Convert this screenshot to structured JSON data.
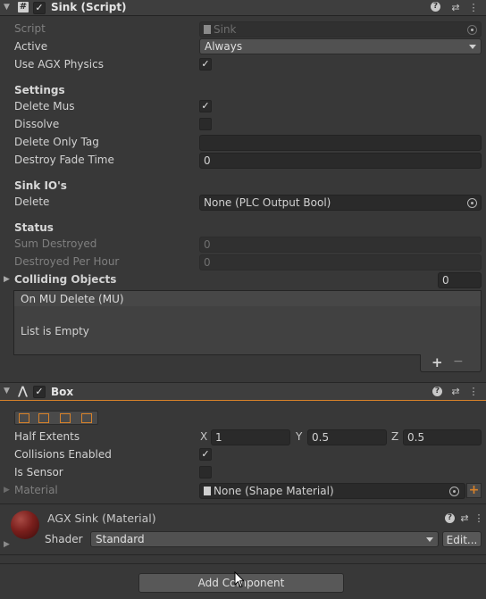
{
  "sink_component": {
    "title": "Sink (Script)",
    "script_label": "Script",
    "script_value": "Sink",
    "active_label": "Active",
    "active_value": "Always",
    "use_agx_label": "Use AGX Physics",
    "settings_header": "Settings",
    "delete_mus_label": "Delete Mus",
    "dissolve_label": "Dissolve",
    "delete_only_tag_label": "Delete Only Tag",
    "delete_only_tag_value": "",
    "destroy_fade_label": "Destroy Fade Time",
    "destroy_fade_value": "0",
    "sink_io_header": "Sink IO's",
    "delete_label": "Delete",
    "delete_value": "None (PLC Output Bool)",
    "status_header": "Status",
    "sum_destroyed_label": "Sum Destroyed",
    "sum_destroyed_value": "0",
    "destroyed_per_hour_label": "Destroyed Per Hour",
    "destroyed_per_hour_value": "0",
    "colliding_label": "Colliding Objects",
    "colliding_count": "0",
    "event_header": "On MU Delete (MU)",
    "list_empty": "List is Empty",
    "plus": "+",
    "minus": "−"
  },
  "box_component": {
    "title": "Box",
    "half_extents_label": "Half Extents",
    "x_label": "X",
    "x_value": "1",
    "y_label": "Y",
    "y_value": "0.5",
    "z_label": "Z",
    "z_value": "0.5",
    "collisions_label": "Collisions Enabled",
    "is_sensor_label": "Is Sensor",
    "material_label": "Material",
    "material_value": "None (Shape Material)",
    "accent_color": "#d8822a"
  },
  "material_component": {
    "title": "AGX Sink (Material)",
    "shader_label": "Shader",
    "shader_value": "Standard",
    "edit_label": "Edit..."
  },
  "footer": {
    "add_component_label": "Add Component"
  },
  "icons": {
    "check": "✓",
    "help": "?",
    "settings": "⇄",
    "more": "⋮"
  }
}
